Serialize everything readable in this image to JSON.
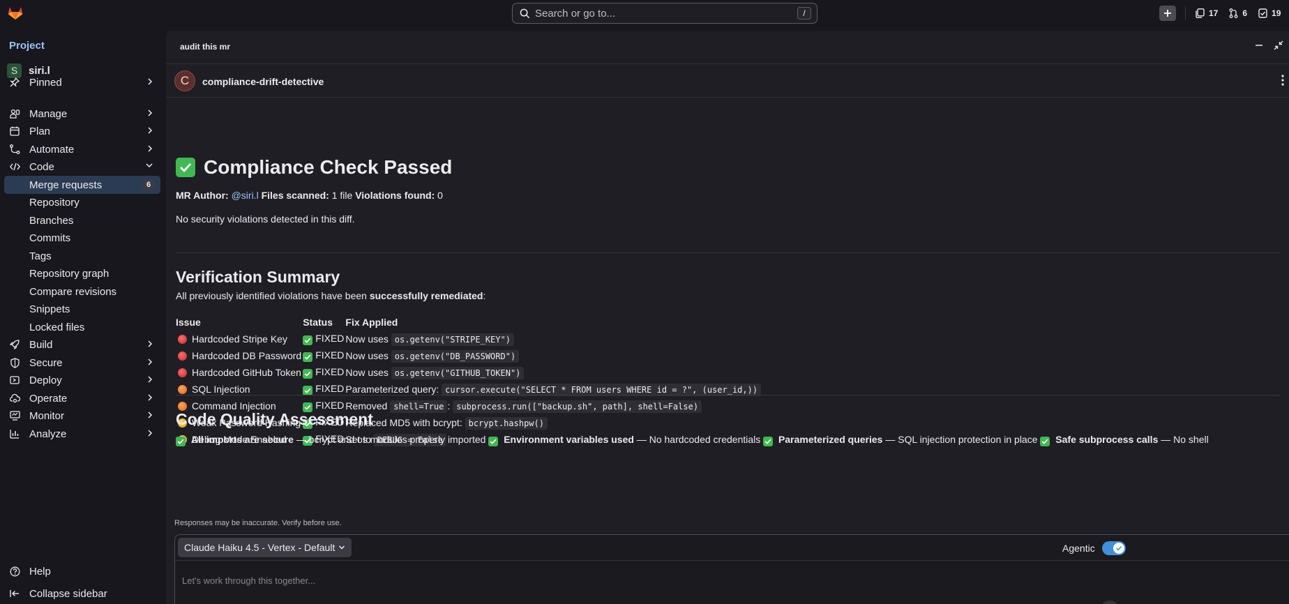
{
  "topbar": {
    "search_placeholder": "Search or go to...",
    "search_shortcut": "/",
    "counts": {
      "issues": "17",
      "merge_requests": "6",
      "todos": "19"
    }
  },
  "sidebar": {
    "section_label": "Project",
    "project": {
      "avatar_letter": "S",
      "name": "siri.l"
    },
    "items": {
      "pinned": "Pinned",
      "manage": "Manage",
      "plan": "Plan",
      "automate": "Automate",
      "code": "Code",
      "merge_requests": "Merge requests",
      "merge_requests_count": "6",
      "repository": "Repository",
      "branches": "Branches",
      "commits": "Commits",
      "tags": "Tags",
      "repository_graph": "Repository graph",
      "compare_revisions": "Compare revisions",
      "snippets": "Snippets",
      "locked_files": "Locked files",
      "build": "Build",
      "secure": "Secure",
      "deploy": "Deploy",
      "operate": "Operate",
      "monitor": "Monitor",
      "analyze": "Analyze",
      "help": "Help",
      "collapse": "Collapse sidebar"
    }
  },
  "panel": {
    "title": "audit this mr",
    "agent": {
      "avatar_letter": "C",
      "name": "compliance-drift-detective"
    }
  },
  "report": {
    "title": "Compliance Check Passed",
    "meta": {
      "author_label": "MR Author:",
      "author": "@siri.l",
      "files_label": "Files scanned:",
      "files": "1 file",
      "violations_label": "Violations found:",
      "violations": "0"
    },
    "no_violations": "No security violations detected in this diff.",
    "verification": {
      "heading": "Verification Summary",
      "intro_prefix": "All previously identified violations have been ",
      "intro_bold": "successfully remediated",
      "intro_suffix": ":",
      "headers": {
        "issue": "Issue",
        "status": "Status",
        "fix": "Fix Applied"
      },
      "rows": [
        {
          "severity": "red",
          "issue": "Hardcoded Stripe Key",
          "status": "FIXED",
          "fix_prefix": "Now uses ",
          "code1": "os.getenv(\"STRIPE_KEY\")",
          "mid": "",
          "code2": ""
        },
        {
          "severity": "red",
          "issue": "Hardcoded DB Password",
          "status": "FIXED",
          "fix_prefix": "Now uses ",
          "code1": "os.getenv(\"DB_PASSWORD\")",
          "mid": "",
          "code2": ""
        },
        {
          "severity": "red",
          "issue": "Hardcoded GitHub Token",
          "status": "FIXED",
          "fix_prefix": "Now uses ",
          "code1": "os.getenv(\"GITHUB_TOKEN\")",
          "mid": "",
          "code2": ""
        },
        {
          "severity": "orange",
          "issue": "SQL Injection",
          "status": "FIXED",
          "fix_prefix": "Parameterized query: ",
          "code1": "cursor.execute(\"SELECT * FROM users WHERE id = ?\", (user_id,))",
          "mid": "",
          "code2": ""
        },
        {
          "severity": "orange",
          "issue": "Command Injection",
          "status": "FIXED",
          "fix_prefix": "Removed ",
          "code1": "shell=True",
          "mid": ": ",
          "code2": "subprocess.run([\"backup.sh\", path], shell=False)"
        },
        {
          "severity": "yellow",
          "issue": "Weak Password Hashing",
          "status": "FIXED",
          "fix_prefix": "Replaced MD5 with bcrypt: ",
          "code1": "bcrypt.hashpw()",
          "mid": "",
          "code2": ""
        },
        {
          "severity": "yellow",
          "issue": "Debug Mode Enabled",
          "status": "FIXED",
          "fix_prefix": "Set to ",
          "code1": "DEBUG = False",
          "mid": "",
          "code2": ""
        }
      ]
    },
    "quality": {
      "heading": "Code Quality Assessment",
      "items": [
        {
          "bold": "All imports are secure",
          "text": " — bcrypt and os modules properly imported "
        },
        {
          "bold": "Environment variables used",
          "text": " — No hardcoded credentials "
        },
        {
          "bold": "Parameterized queries",
          "text": " — SQL injection protection in place "
        },
        {
          "bold": "Safe subprocess calls",
          "text": " — No shell"
        }
      ]
    }
  },
  "composer": {
    "disclaimer": "Responses may be inaccurate. Verify before use.",
    "model": "Claude Haiku 4.5 - Vertex - Default",
    "agentic_label": "Agentic",
    "agentic_on": true,
    "placeholder": "Let's work through this together..."
  },
  "colors": {
    "accent": "#428fdc",
    "link": "#9ac4fb",
    "success": "#3fb950",
    "severity_red": "#e03e3e",
    "severity_orange": "#f0762c",
    "severity_yellow": "#f2b21f"
  }
}
